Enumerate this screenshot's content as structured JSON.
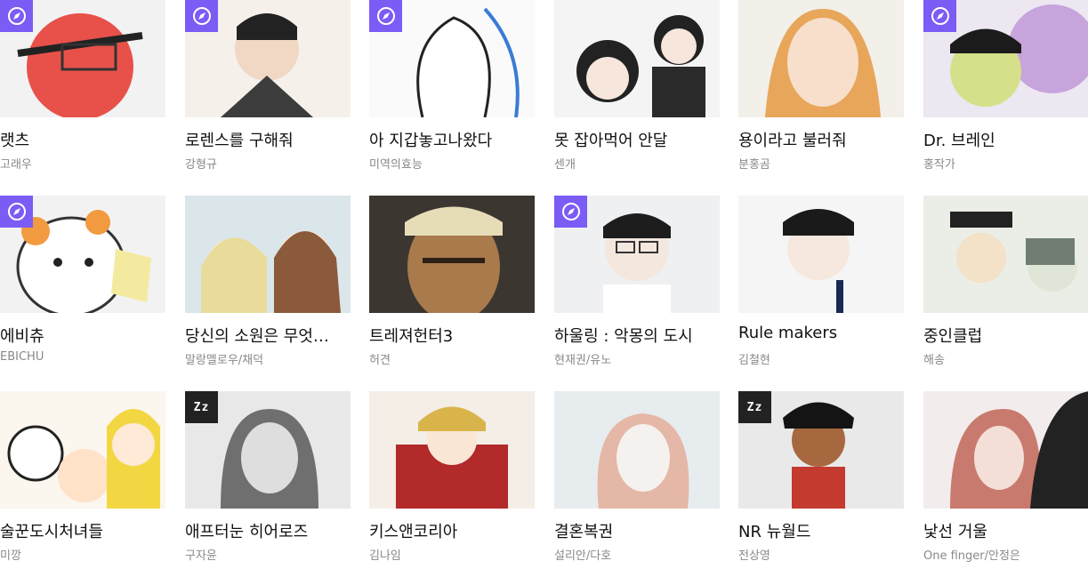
{
  "cards": [
    {
      "title": "랫츠",
      "author": "고래우",
      "badge": "compass",
      "art": "red-face",
      "bg": "#f2f2f2"
    },
    {
      "title": "로렌스를 구해줘",
      "author": "강형규",
      "badge": "compass",
      "art": "suit-man",
      "bg": "#f5f0ea"
    },
    {
      "title": "아 지갑놓고나왔다",
      "author": "미역의효능",
      "badge": "compass",
      "art": "ghost-sketch",
      "bg": "#fafafa"
    },
    {
      "title": "못 잡아먹어 안달",
      "author": "센개",
      "badge": "",
      "art": "two-students",
      "bg": "#f4f4f4"
    },
    {
      "title": "용이라고 불러줘",
      "author": "분홍곰",
      "badge": "",
      "art": "blonde-woman",
      "bg": "#f3efe9"
    },
    {
      "title": "Dr. 브레인",
      "author": "홍작가",
      "badge": "compass",
      "art": "brain-man",
      "bg": "#ece7f0"
    },
    {
      "title": "에비츄",
      "author": "EBICHU",
      "badge": "compass",
      "art": "hamster",
      "bg": "#f2f2f2"
    },
    {
      "title": "당신의 소원은 무엇…",
      "author": "말랑멜로우/채덕",
      "badge": "",
      "art": "two-girls",
      "bg": "#dbe6ea"
    },
    {
      "title": "트레져헌터3",
      "author": "허견",
      "badge": "",
      "art": "rugged-man",
      "bg": "#3b3630"
    },
    {
      "title": "하울링 : 악몽의 도시",
      "author": "현재권/유노",
      "badge": "compass",
      "art": "glasses-man",
      "bg": "#eef0f2"
    },
    {
      "title": "Rule makers",
      "author": "김철현",
      "badge": "",
      "art": "tie-man",
      "bg": "#f5f5f5"
    },
    {
      "title": "중인클럽",
      "author": "해송",
      "badge": "",
      "art": "hat-men",
      "bg": "#eaeee6"
    },
    {
      "title": "술꾼도시처녀들",
      "author": "미깡",
      "badge": "",
      "art": "three-friends",
      "bg": "#fbf6ee"
    },
    {
      "title": "애프터눈 히어로즈",
      "author": "구자윤",
      "badge": "zz",
      "art": "gray-girl",
      "bg": "#e8e8e8"
    },
    {
      "title": "키스앤코리아",
      "author": "김나임",
      "badge": "",
      "art": "queen",
      "bg": "#f4eee6"
    },
    {
      "title": "결혼복권",
      "author": "설리안/다호",
      "badge": "",
      "art": "pale-woman",
      "bg": "#e7ecee"
    },
    {
      "title": "NR 뉴월드",
      "author": "전상영",
      "badge": "zz",
      "art": "fighter",
      "bg": "#e9e9e9"
    },
    {
      "title": "낯선 거울",
      "author": "One finger/안정은",
      "badge": "",
      "art": "mirror-women",
      "bg": "#f3ecec"
    }
  ],
  "badge_labels": {
    "zz": "Zz"
  },
  "colors": {
    "badge_purple": "#7b5cf5",
    "badge_dark": "#222222",
    "title": "#111111",
    "author": "#888888"
  }
}
